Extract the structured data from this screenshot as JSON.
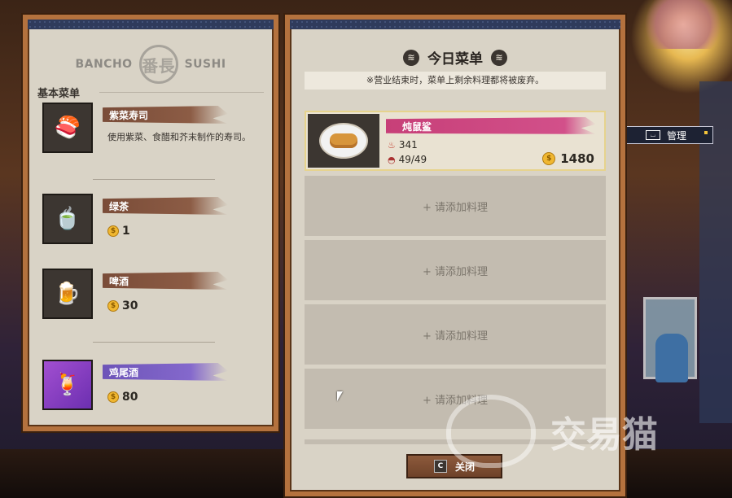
{
  "left": {
    "brand_left": "BANCHO",
    "brand_logo": "番長",
    "brand_right": "SUSHI",
    "section_title": "基本菜单",
    "items": [
      {
        "name": "紫菜寿司",
        "desc": "使用紫菜、食醋和芥末制作的寿司。",
        "icon": "sushi-roll-icon"
      },
      {
        "name": "绿茶",
        "price": "1",
        "icon": "green-tea-icon"
      },
      {
        "name": "啤酒",
        "price": "30",
        "icon": "beer-icon"
      },
      {
        "name": "鸡尾酒",
        "price": "80",
        "icon": "cocktail-icon"
      }
    ]
  },
  "right": {
    "title": "今日菜单",
    "notice": "※营业结束时，菜单上剩余料理都将被废弃。",
    "filled_slot": {
      "name": "炖鼠鲨",
      "taste": "341",
      "servings": "49/49",
      "price": "1480"
    },
    "empty_slot_label": "+ 请添加料理",
    "close_key": "C",
    "close_label": "关闭"
  },
  "manage": {
    "key": "⌴",
    "label": "管理"
  },
  "watermark": "交易猫"
}
